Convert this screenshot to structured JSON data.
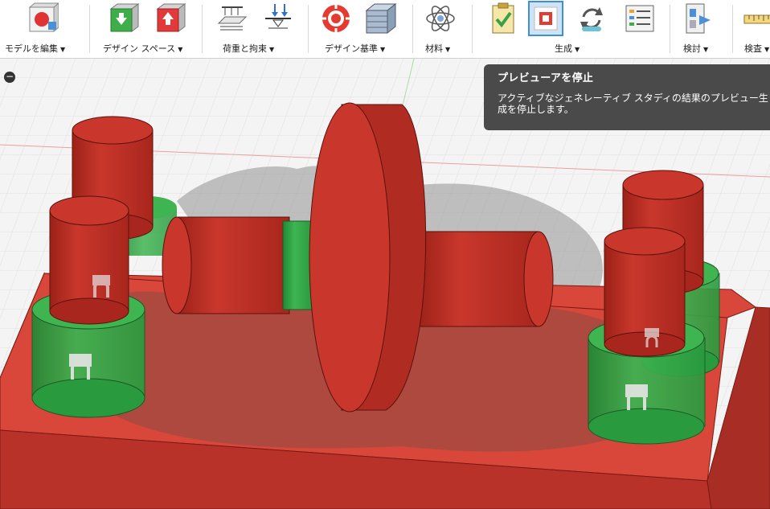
{
  "toolbar": {
    "groups": [
      {
        "label": "モデルを編集"
      },
      {
        "label": "デザイン スペース"
      },
      {
        "label": "荷重と拘束"
      },
      {
        "label": "デザイン基準"
      },
      {
        "label": "材料"
      },
      {
        "label": "生成"
      },
      {
        "label": "検討"
      },
      {
        "label": "検査"
      }
    ],
    "caret": "▼",
    "icons": [
      "edit-model-icon",
      "preserve-geometry-icon",
      "obstacle-geometry-icon",
      "structural-load-icon",
      "structural-constraint-icon",
      "objectives-icon",
      "manufacturing-icon",
      "material-icon",
      "precheck-icon",
      "stop-preview-icon",
      "generate-icon",
      "study-list-icon",
      "explore-icon",
      "measure-icon"
    ],
    "active_tool": "stop-preview-icon"
  },
  "tooltip": {
    "title": "プレビューアを停止",
    "description": "アクティブなジェネレーティブ スタディの結果のプレビュー生成を停止します。"
  },
  "browser_toggle": "−",
  "colors": {
    "preserve": "#c9372c",
    "obstacle": "#2ea043",
    "outcome": "#8c4a45",
    "tooltip_bg": "#4a4a4a",
    "active_highlight": "#3d8fd8"
  }
}
